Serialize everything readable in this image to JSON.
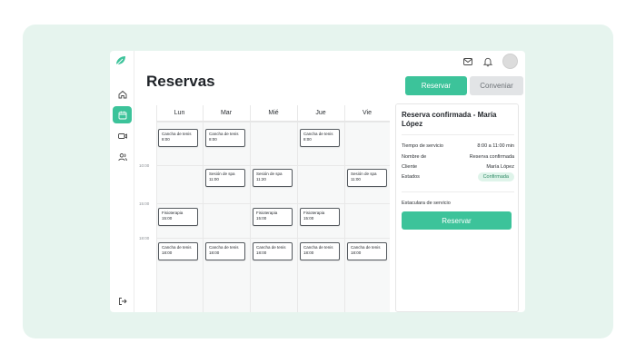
{
  "colors": {
    "accent": "#3cc39a",
    "background": "#e6f4ee",
    "badge_bg": "#dff4ea",
    "badge_text": "#2f8a66"
  },
  "icons": {
    "logo": "leaf-logo-icon",
    "nav": [
      "home-icon",
      "calendar-icon",
      "video-icon",
      "users-icon"
    ],
    "logout": "logout-icon",
    "top": [
      "mail-icon",
      "bell-icon"
    ]
  },
  "header": {
    "title": "Reservas",
    "reserve_button": "Reservar",
    "convene_button": "Conveniar"
  },
  "calendar": {
    "days": [
      "Lun",
      "Mar",
      "Mié",
      "Jue",
      "Vie"
    ],
    "time_labels": [
      "10:00",
      "15:00",
      "18:00"
    ],
    "events": [
      {
        "name": "Cancha de tenis",
        "time": "8:00"
      },
      {
        "name": "Cancha de tenis",
        "time": "8:00"
      },
      {
        "name": "Cancha de tenis",
        "time": "8:00"
      },
      {
        "name": "Sesión de spa",
        "time": "11:00"
      },
      {
        "name": "Sesión de spa",
        "time": "11:20"
      },
      {
        "name": "Sesión de spa",
        "time": "11:00"
      },
      {
        "name": "Fisioterapia",
        "time": "15:00"
      },
      {
        "name": "Fisioterapia",
        "time": "15:00"
      },
      {
        "name": "Fisioterapia",
        "time": "15:00"
      },
      {
        "name": "Cancha de tenis",
        "time": "18:00"
      },
      {
        "name": "Cancha de tenis",
        "time": "18:00"
      },
      {
        "name": "Cancha de tenis",
        "time": "18:00"
      },
      {
        "name": "Cancha de tenis",
        "time": "18:00"
      },
      {
        "name": "Cancha de tenis",
        "time": "18:00"
      }
    ]
  },
  "panel": {
    "title": "Reserva confirmada - María López",
    "rows": [
      {
        "label": "Tiempo de servicio",
        "value": "8:00 a 11:00 min"
      },
      {
        "label": "Nombre de",
        "value": "Reserva confirmada"
      },
      {
        "label": "Cliente",
        "value": "María López"
      },
      {
        "label": "Estados",
        "value": "Confirmada"
      }
    ],
    "section_label": "Estaculara de servicio",
    "button": "Reservar"
  }
}
